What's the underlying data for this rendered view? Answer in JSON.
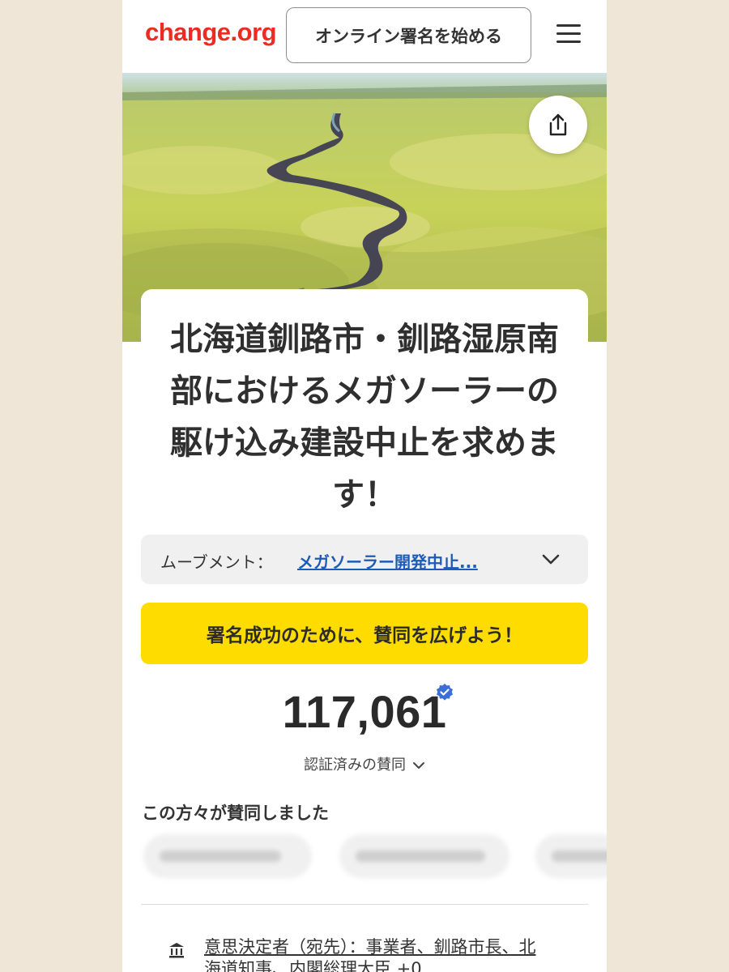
{
  "header": {
    "logo": "change.org",
    "start_button": "オンライン署名を始める",
    "menu_icon": "hamburger-menu-icon"
  },
  "hero": {
    "share_icon": "share-icon"
  },
  "petition": {
    "title": "北海道釧路市・釧路湿原南部におけるメガソーラーの駆け込み建設中止を求めます！"
  },
  "movement": {
    "label": "ムーブメント：",
    "link": "メガソーラー開発中止..."
  },
  "cta": {
    "label": "署名成功のために、賛同を広げよう！"
  },
  "signatures": {
    "count": "117,061",
    "verified_label": "認証済みの賛同",
    "verified_icon": "verified-badge-icon"
  },
  "supporters": {
    "heading": "この方々が賛同しました"
  },
  "decision_makers": {
    "icon": "institution-icon",
    "text": "意思決定者（宛先）：事業者、釧路市長、北海道知事、内閣総理大臣 +0"
  },
  "colors": {
    "brand_red": "#ec2c22",
    "cta_yellow": "#ffdc00",
    "link_blue": "#1e5bb8",
    "verified_blue": "#3b6fd8"
  }
}
